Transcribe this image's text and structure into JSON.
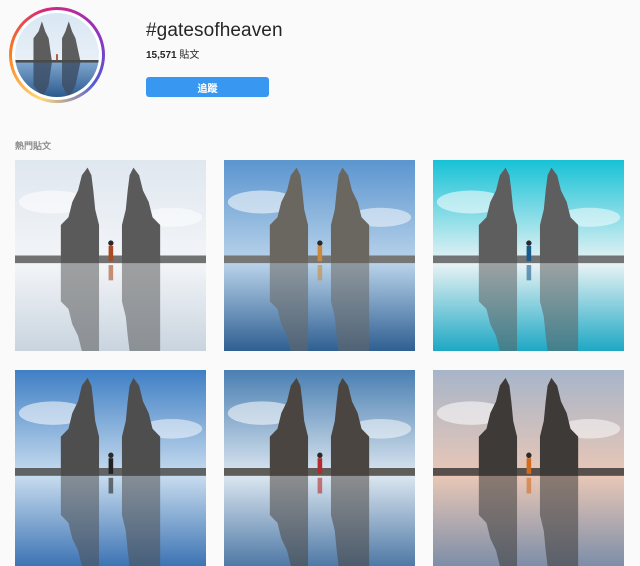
{
  "hashtag": {
    "title": "#gatesofheaven",
    "post_count": "15,571",
    "post_count_unit": "貼文",
    "follow_label": "追蹤"
  },
  "section": {
    "top_posts_label": "熱門貼文"
  },
  "colors": {
    "follow_button": "#3897f0",
    "background": "#fafafa",
    "muted_text": "#8e8e8e"
  },
  "posts": [
    {
      "sky_top": "#dfe7ef",
      "sky_bottom": "#f3f5f8",
      "water": "#c9d4df",
      "stone": "#5a5a5a",
      "figure": "#a84b22"
    },
    {
      "sky_top": "#5b95cf",
      "sky_bottom": "#b9d3ea",
      "water": "#2f5f92",
      "stone": "#6a6660",
      "figure": "#c98a3a"
    },
    {
      "sky_top": "#17c2d6",
      "sky_bottom": "#e9f3f5",
      "water": "#1ea8c4",
      "stone": "#5e5e5e",
      "figure": "#1a5a8a"
    },
    {
      "sky_top": "#3f7fc4",
      "sky_bottom": "#c8dcef",
      "water": "#3d74b4",
      "stone": "#4e4e4e",
      "figure": "#222222"
    },
    {
      "sky_top": "#4a7fb2",
      "sky_bottom": "#dbe6f0",
      "water": "#4f79a6",
      "stone": "#4a4540",
      "figure": "#b32b2b"
    },
    {
      "sky_top": "#a7b5c9",
      "sky_bottom": "#e9c7b6",
      "water": "#7d8ea8",
      "stone": "#3d3a38",
      "figure": "#d06a1f"
    }
  ]
}
